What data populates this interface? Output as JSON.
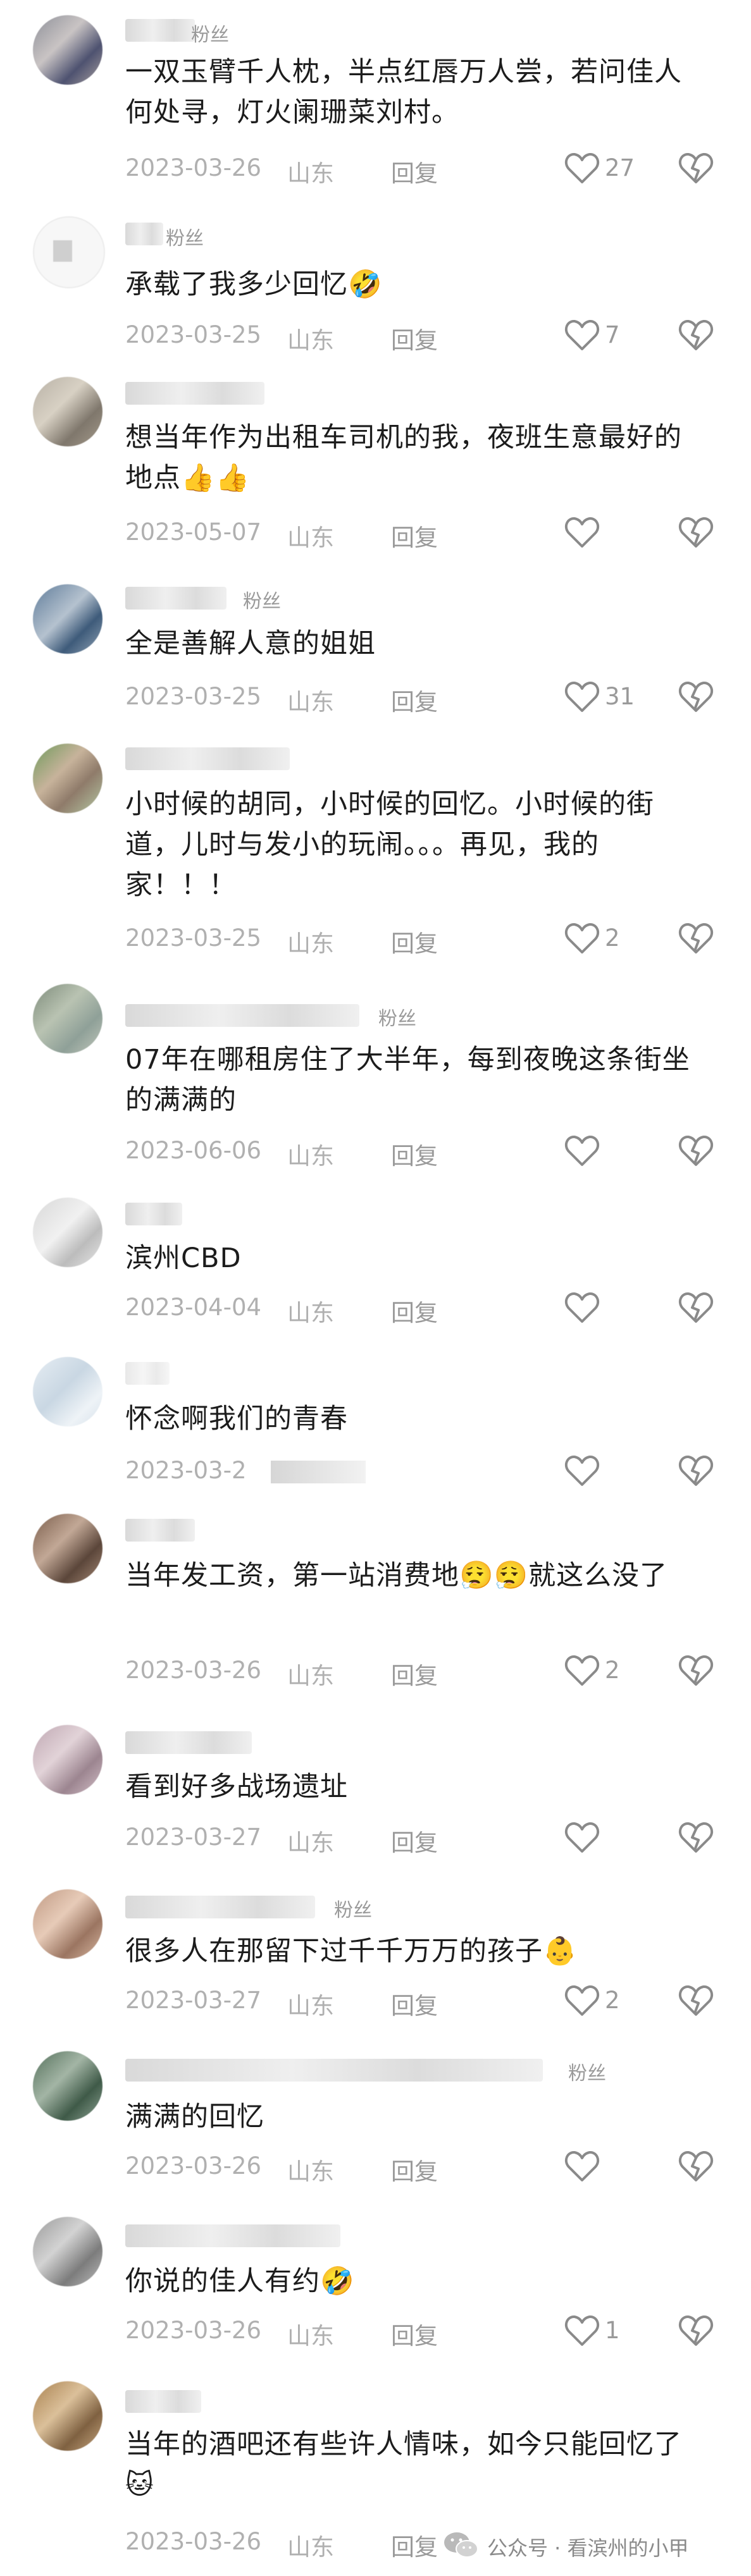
{
  "comments": [
    {
      "text": "一双玉臂千人枕，半点红唇万人尝，若问佳人何处寻，灯火阑珊菜刘村。",
      "date": "2023-03-26",
      "location": "山东",
      "reply": "回复",
      "likes": "27",
      "fans_badge": "粉丝"
    },
    {
      "text": "承载了我多少回忆🤣",
      "date": "2023-03-25",
      "location": "山东",
      "reply": "回复",
      "likes": "7",
      "fans_badge": "粉丝"
    },
    {
      "text": "想当年作为出租车司机的我，夜班生意最好的地点👍👍",
      "date": "2023-05-07",
      "location": "山东",
      "reply": "回复",
      "likes": "",
      "fans_badge": ""
    },
    {
      "text": "全是善解人意的姐姐",
      "date": "2023-03-25",
      "location": "山东",
      "reply": "回复",
      "likes": "31",
      "fans_badge": "粉丝"
    },
    {
      "text": "小时候的胡同，小时候的回忆。小时候的街道，儿时与发小的玩闹。。。再见，我的家！！！",
      "date": "2023-03-25",
      "location": "山东",
      "reply": "回复",
      "likes": "2",
      "fans_badge": ""
    },
    {
      "text": "07年在哪租房住了大半年，每到夜晚这条街坐的满满的",
      "date": "2023-06-06",
      "location": "山东",
      "reply": "回复",
      "likes": "",
      "fans_badge": "粉丝"
    },
    {
      "text": "滨州CBD",
      "date": "2023-04-04",
      "location": "山东",
      "reply": "回复",
      "likes": "",
      "fans_badge": ""
    },
    {
      "text": "怀念啊我们的青春",
      "date": "2023-03-2",
      "location": "",
      "reply": "",
      "likes": "",
      "fans_badge": ""
    },
    {
      "text": "当年发工资，第一站消费地😮‍💨😮‍💨就这么没了",
      "date": "2023-03-26",
      "location": "山东",
      "reply": "回复",
      "likes": "2",
      "fans_badge": ""
    },
    {
      "text": "看到好多战场遗址",
      "date": "2023-03-27",
      "location": "山东",
      "reply": "回复",
      "likes": "",
      "fans_badge": ""
    },
    {
      "text": "很多人在那留下过千千万万的孩子👶",
      "date": "2023-03-27",
      "location": "山东",
      "reply": "回复",
      "likes": "2",
      "fans_badge": "粉丝"
    },
    {
      "text": "满满的回忆",
      "date": "2023-03-26",
      "location": "山东",
      "reply": "回复",
      "likes": "",
      "fans_badge": "粉丝"
    },
    {
      "text": "你说的佳人有约🤣",
      "date": "2023-03-26",
      "location": "山东",
      "reply": "回复",
      "likes": "1",
      "fans_badge": ""
    },
    {
      "text": "当年的酒吧还有些许人情味，如今只能回忆了🐱",
      "date": "2023-03-26",
      "location": "山东",
      "reply": "回复",
      "likes": "",
      "fans_badge": ""
    }
  ],
  "watermark": {
    "text": "公众号 · 看滨州的小甲"
  },
  "colors": {
    "text": "#1c1c1c",
    "meta": "#b0b0b0",
    "icon": "#9a9a9a",
    "background": "#ffffff"
  },
  "icons": {
    "like": "heart-outline-icon",
    "dislike": "broken-heart-icon",
    "watermark": "wechat-icon"
  }
}
